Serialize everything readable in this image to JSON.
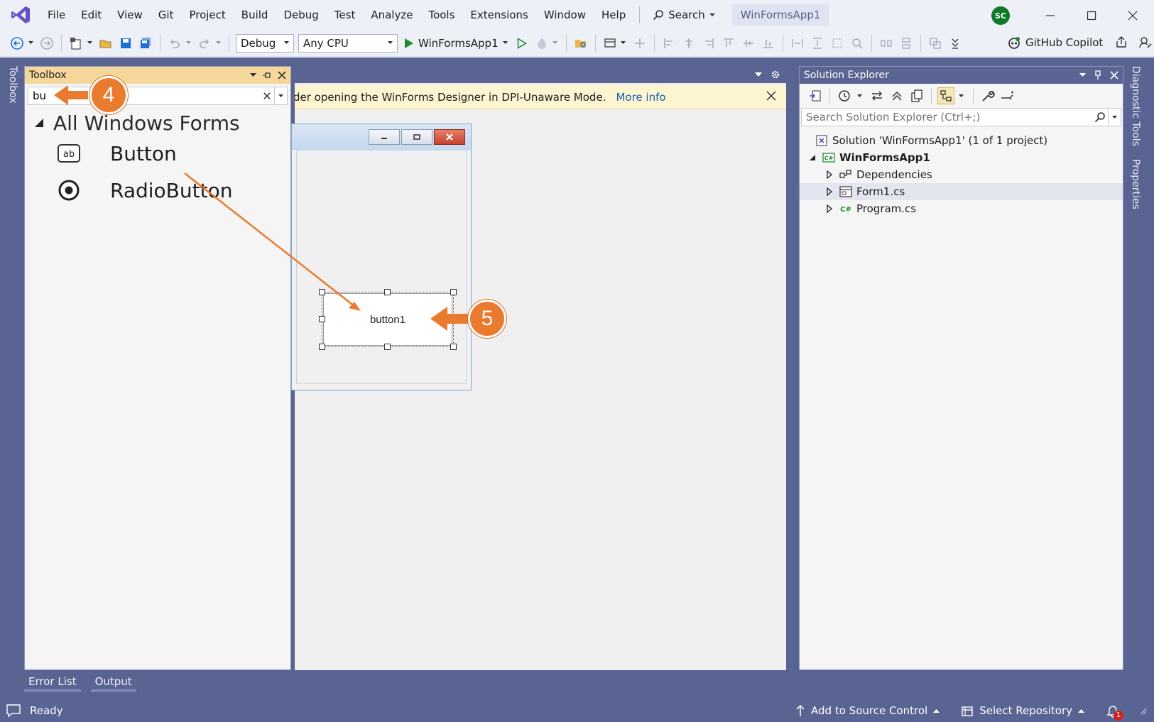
{
  "window": {
    "menu": [
      "File",
      "Edit",
      "View",
      "Git",
      "Project",
      "Build",
      "Debug",
      "Test",
      "Analyze",
      "Tools",
      "Extensions",
      "Window",
      "Help"
    ],
    "search_label": "Search",
    "title": "WinFormsApp1",
    "user_initials": "SC"
  },
  "toolbar": {
    "config": "Debug",
    "platform": "Any CPU",
    "start_label": "WinFormsApp1",
    "copilot_label": "GitHub Copilot"
  },
  "toolbox": {
    "side_tab": "Toolbox",
    "title": "Toolbox",
    "search_value": "bu",
    "group_label": "All Windows Forms",
    "items": [
      {
        "label": "Button",
        "icon": "button-control-icon"
      },
      {
        "label": "RadioButton",
        "icon": "radio-button-icon"
      }
    ]
  },
  "designer": {
    "infobar_text": "der opening the WinForms Designer in DPI-Unaware Mode.",
    "infobar_link": "More info",
    "button_text": "button1"
  },
  "solution_explorer": {
    "title": "Solution Explorer",
    "search_placeholder": "Search Solution Explorer (Ctrl+;)",
    "solution_label": "Solution 'WinFormsApp1' (1 of 1 project)",
    "project_label": "WinFormsApp1",
    "children": [
      "Dependencies",
      "Form1.cs",
      "Program.cs"
    ]
  },
  "right_tabs": [
    "Diagnostic Tools",
    "Properties"
  ],
  "bottom_tabs": [
    "Error List",
    "Output"
  ],
  "status": {
    "ready": "Ready",
    "source_control": "Add to Source Control",
    "repository": "Select Repository",
    "notifications": "1"
  },
  "callouts": [
    "4",
    "5"
  ],
  "colors": {
    "accent": "#5a6493",
    "callout": "#ea7a2d",
    "toolbox_header": "#f5d79b",
    "infobar": "#fdf4d0"
  }
}
